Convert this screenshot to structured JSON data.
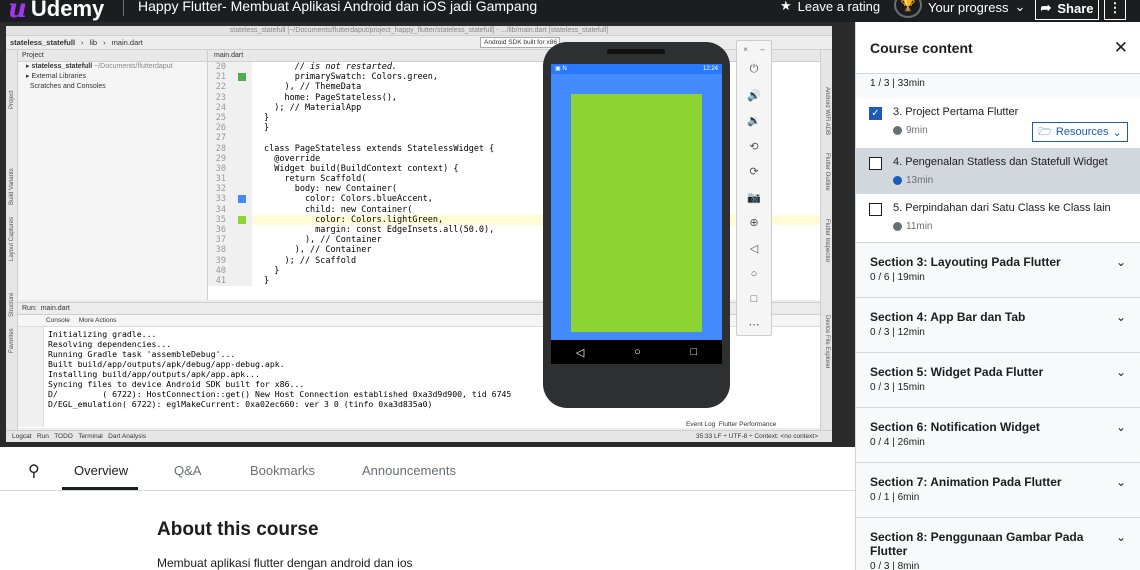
{
  "topbar": {
    "logo": "Udemy",
    "course_title": "Happy Flutter- Membuat Aplikasi Android dan iOS jadi Gampang",
    "rating_label": "Leave a rating",
    "progress_label": "Your progress",
    "share_label": "Share"
  },
  "ide": {
    "window_title": "stateless_statefull [~/Documents/flutterdaput/project_happy_flutter/stateless_statefull] - .../lib/main.dart [stateless_statefull]",
    "breadcrumb": [
      "stateless_statefull",
      "lib",
      "main.dart"
    ],
    "device": "Android SDK built for x86",
    "project_header": "Project",
    "project_tree": [
      {
        "name": "stateless_statefull",
        "path": "~/Documents/flutterdaput"
      },
      {
        "name": "External Libraries",
        "path": ""
      },
      {
        "name": "Scratches and Consoles",
        "path": ""
      }
    ],
    "editor_tab": "main.dart",
    "code_lines": [
      {
        "n": "20",
        "text": "      // is not restarted.",
        "type": "cm"
      },
      {
        "n": "21",
        "text": "      primarySwatch: Colors.green,",
        "type": "code"
      },
      {
        "n": "22",
        "text": "    ), // ThemeData",
        "type": "code"
      },
      {
        "n": "23",
        "text": "    home: PageStateless(),",
        "type": "code"
      },
      {
        "n": "24",
        "text": "  ); // MaterialApp",
        "type": "code"
      },
      {
        "n": "25",
        "text": "}",
        "type": "code"
      },
      {
        "n": "26",
        "text": "}",
        "type": "code"
      },
      {
        "n": "27",
        "text": "",
        "type": "code"
      },
      {
        "n": "28",
        "text": "class PageStateless extends StatelessWidget {",
        "type": "code"
      },
      {
        "n": "29",
        "text": "  @override",
        "type": "code"
      },
      {
        "n": "30",
        "text": "  Widget build(BuildContext context) {",
        "type": "code"
      },
      {
        "n": "31",
        "text": "    return Scaffold(",
        "type": "code"
      },
      {
        "n": "32",
        "text": "      body: new Container(",
        "type": "code"
      },
      {
        "n": "33",
        "text": "        color: Colors.blueAccent,",
        "type": "code"
      },
      {
        "n": "34",
        "text": "        child: new Container(",
        "type": "code"
      },
      {
        "n": "35",
        "text": "          color: Colors.lightGreen,",
        "type": "code"
      },
      {
        "n": "36",
        "text": "          margin: const EdgeInsets.all(50.0),",
        "type": "code"
      },
      {
        "n": "37",
        "text": "        ), // Container",
        "type": "code"
      },
      {
        "n": "38",
        "text": "      ), // Container",
        "type": "code"
      },
      {
        "n": "39",
        "text": "    ); // Scaffold",
        "type": "code"
      },
      {
        "n": "40",
        "text": "  }",
        "type": "code"
      },
      {
        "n": "41",
        "text": "}",
        "type": "code"
      }
    ],
    "run_label": "Run:",
    "run_tab": "main.dart",
    "console_tab": "Console",
    "more_actions": "More Actions",
    "console_lines": [
      "Initializing gradle...",
      "Resolving dependencies...",
      "Running Gradle task 'assembleDebug'...",
      "Built build/app/outputs/apk/debug/app-debug.apk.",
      "Installing build/app/outputs/apk/app.apk...",
      "Syncing files to device Android SDK built for x86...",
      "D/         ( 6722): HostConnection::get() New Host Connection established 0xa3d9d900, tid 6745",
      "D/EGL_emulation( 6722): eglMakeCurrent: 0xa02ec660: ver 3 0 (tinfo 0xa3d835a0)"
    ],
    "bottom_tabs": [
      "Logcat",
      "Run",
      "TODO",
      "Terminal",
      "Dart Analysis"
    ],
    "event_log": "Event Log",
    "flutter_performance": "Flutter Performance",
    "status_right": "35:33  LF ÷  UTF-8 ÷  Context: <no context>",
    "left_tool_labels": [
      "Project",
      "Build Variants",
      "Layout Captures",
      "Structure",
      "Favorites"
    ],
    "right_tool_labels": [
      "Android WiFi ADB",
      "Flutter Outline",
      "Flutter Inspector",
      "Device File Explorer"
    ],
    "phone_time": "12:24"
  },
  "tabs": {
    "items": [
      "Overview",
      "Q&A",
      "Bookmarks",
      "Announcements"
    ],
    "active": "Overview"
  },
  "about": {
    "title": "About this course",
    "description": "Membuat aplikasi flutter dengan android dan ios"
  },
  "sidebar": {
    "header": "Course content",
    "current_section_meta": "1 / 3 | 33min",
    "lectures": [
      {
        "title": "3. Project Pertama Flutter",
        "duration": "9min",
        "checked": true,
        "resources": "Resources"
      },
      {
        "title": "4. Pengenalan Statless dan Statefull Widget",
        "duration": "13min",
        "checked": false,
        "current": true
      },
      {
        "title": "5. Perpindahan dari Satu Class ke Class lain",
        "duration": "11min",
        "checked": false
      }
    ],
    "sections": [
      {
        "title": "Section 3: Layouting Pada Flutter",
        "meta": "0 / 6 | 19min"
      },
      {
        "title": "Section 4: App Bar dan Tab",
        "meta": "0 / 3 | 12min"
      },
      {
        "title": "Section 5: Widget Pada Flutter",
        "meta": "0 / 3 | 15min"
      },
      {
        "title": "Section 6: Notification Widget",
        "meta": "0 / 4 | 26min"
      },
      {
        "title": "Section 7: Animation Pada Flutter",
        "meta": "0 / 1 | 6min"
      },
      {
        "title": "Section 8: Penggunaan Gambar Pada Flutter",
        "meta": "0 / 3 | 8min"
      }
    ]
  },
  "colors": {
    "udemy_purple": "#a435f0",
    "accent_blue": "#1c5bb8",
    "phone_blue": "#448aff",
    "phone_green": "#8bd432"
  }
}
